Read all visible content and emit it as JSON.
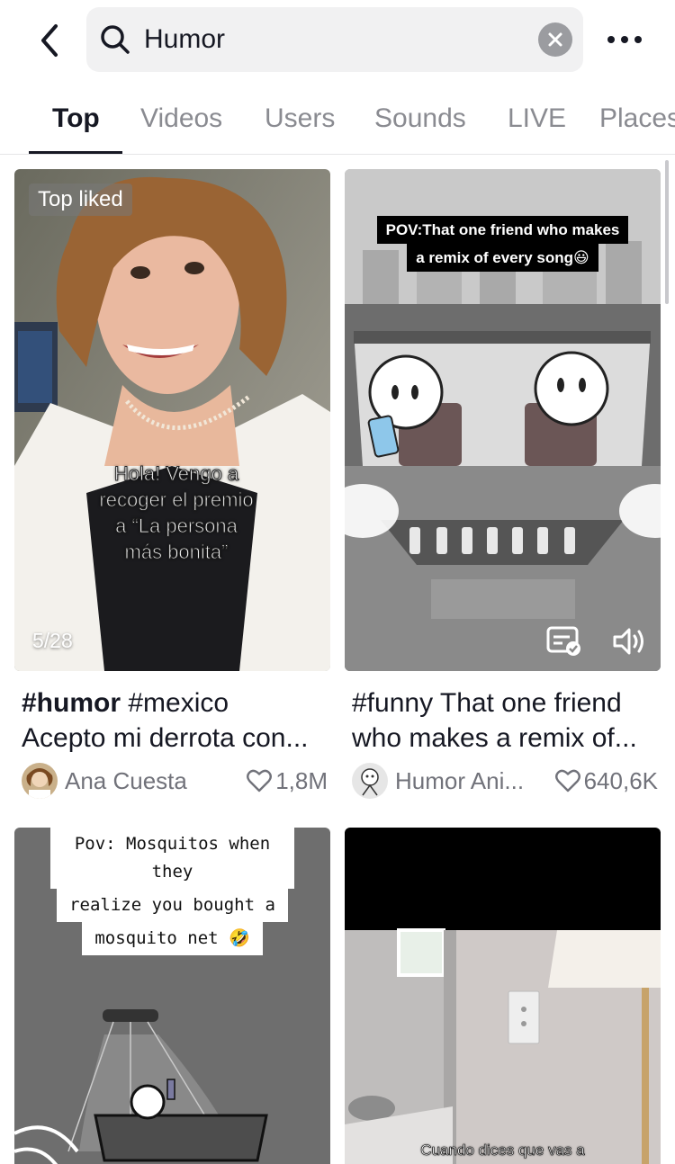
{
  "header": {
    "search_query": "Humor",
    "icons": {
      "back": "chevron-left-icon",
      "search": "search-icon",
      "clear": "close-icon",
      "more": "more-horizontal-icon"
    }
  },
  "tabs": [
    {
      "label": "Top",
      "active": true
    },
    {
      "label": "Videos",
      "active": false
    },
    {
      "label": "Users",
      "active": false
    },
    {
      "label": "Sounds",
      "active": false
    },
    {
      "label": "LIVE",
      "active": false
    },
    {
      "label": "Places",
      "active": false
    }
  ],
  "results": [
    {
      "badge": "Top liked",
      "counter": "5/28",
      "overlay_lines": [
        "Hola! Vengo a",
        "recoger el premio",
        "a “La persona",
        "más bonita”"
      ],
      "caption_hashtag": "#humor",
      "caption_rest": " #mexico",
      "caption_line2": "Acepto mi derrota con...",
      "author": "Ana Cuesta",
      "likes": "1,8M"
    },
    {
      "overlay_lines": [
        "POV:That one friend who makes",
        "a remix of every song😃"
      ],
      "caption_line1": "#funny That one friend",
      "caption_line2": "who makes a remix of...",
      "author": "Humor Ani...",
      "likes": "640,6K",
      "icons": {
        "captions": "captions-icon",
        "sound": "volume-icon"
      }
    },
    {
      "overlay_lines": [
        "Pov: Mosquitos when they",
        "realize you bought a",
        "mosquito net 🤣"
      ]
    },
    {
      "overlay_lines": [
        "Cuando dices que vas a"
      ]
    }
  ]
}
